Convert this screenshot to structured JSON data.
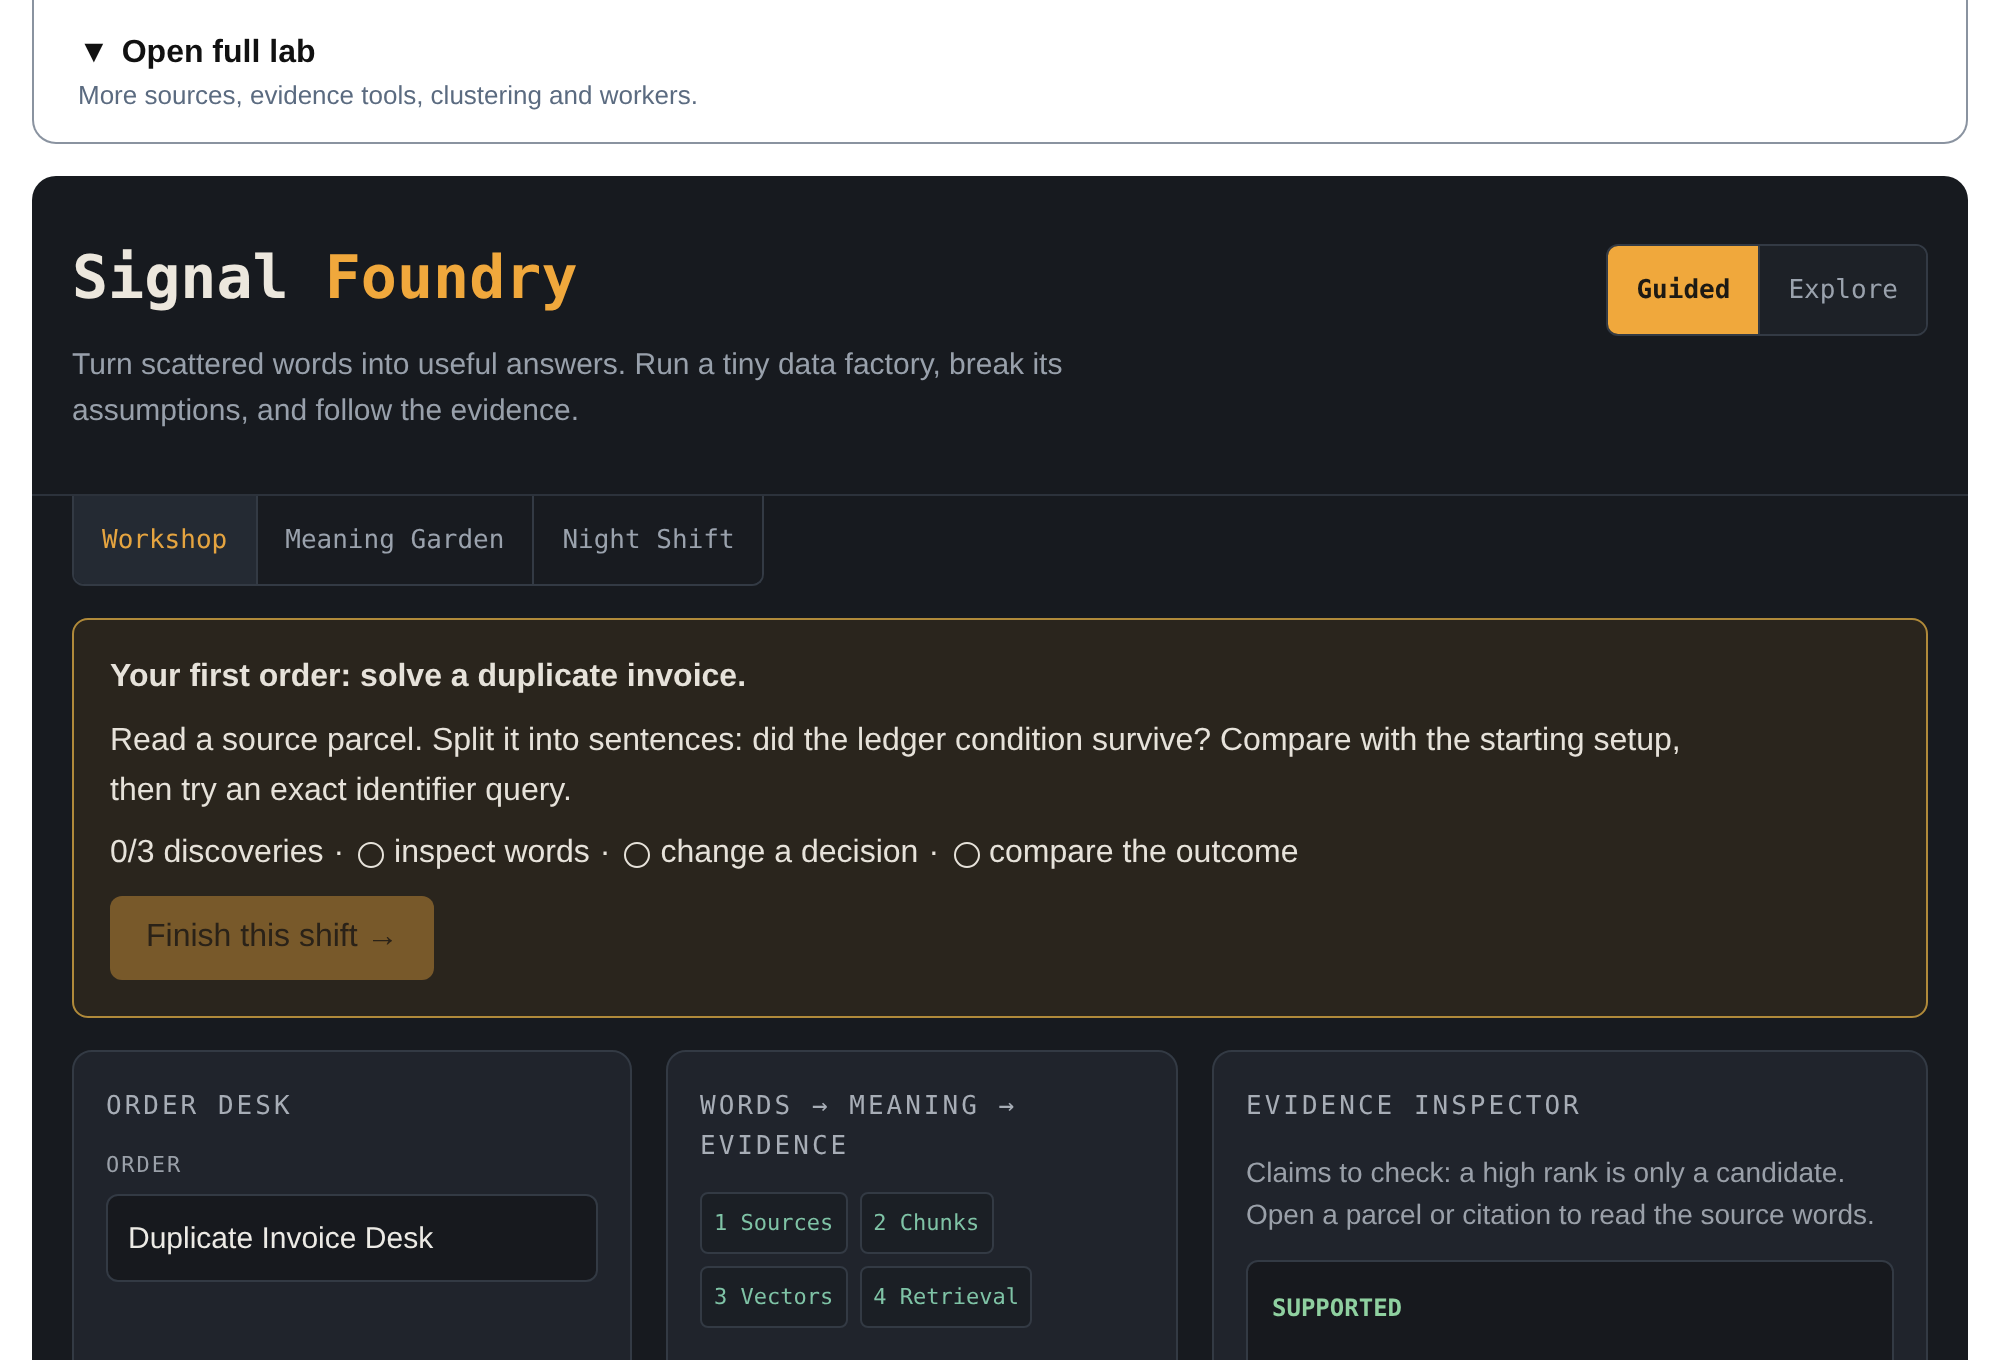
{
  "disclosure": {
    "marker": "▼",
    "title": "Open full lab",
    "subtitle": "More sources, evidence tools, clustering and workers.",
    "expanded": true
  },
  "header": {
    "title_parts": [
      {
        "text": "Signal",
        "accent": false
      },
      {
        "text": "Foundry",
        "accent": true
      }
    ],
    "subtitle": "Turn scattered words into useful answers. Run a tiny data factory, break its assumptions, and follow the evidence."
  },
  "modes": [
    {
      "label": "Guided",
      "selected": true
    },
    {
      "label": "Explore",
      "selected": false
    }
  ],
  "tabs": [
    {
      "label": "Workshop",
      "selected": true
    },
    {
      "label": "Meaning Garden",
      "selected": false
    },
    {
      "label": "Night Shift",
      "selected": false
    }
  ],
  "order_notice": {
    "title": "Your first order: solve a duplicate invoice.",
    "body": "Read a source parcel. Split it into sentences: did the ledger condition survive? Compare with the starting setup, then try an exact identifier query.",
    "progress": "0/3 discoveries",
    "separator": "·",
    "steps": [
      {
        "label": "inspect words",
        "done": false
      },
      {
        "label": "change a decision",
        "done": false
      },
      {
        "label": "compare the outcome",
        "done": false
      }
    ],
    "button": "Finish this shift →",
    "button_disabled": true
  },
  "order_desk": {
    "heading": "ORDER DESK",
    "field_label": "ORDER",
    "field_value": "Duplicate Invoice Desk"
  },
  "pipeline": {
    "heading": "WORDS → MEANING → EVIDENCE",
    "stages": [
      "1 Sources",
      "2 Chunks",
      "3 Vectors",
      "4 Retrieval"
    ]
  },
  "inspector": {
    "heading": "EVIDENCE INSPECTOR",
    "intro": "Claims to check: a high rank is only a candidate. Open a parcel or citation to read the source words.",
    "verdict": "SUPPORTED"
  }
}
